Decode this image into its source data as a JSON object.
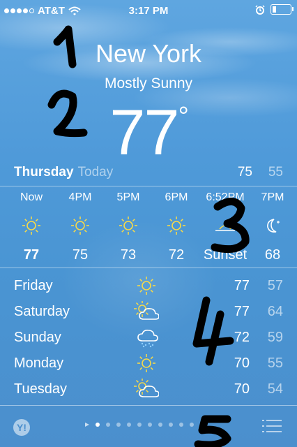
{
  "status": {
    "carrier": "AT&T",
    "time": "3:17 PM"
  },
  "location": {
    "city": "New York",
    "condition": "Mostly Sunny",
    "temperature": "77",
    "degree": "°"
  },
  "today": {
    "day": "Thursday",
    "label": "Today",
    "high": "75",
    "low": "55"
  },
  "hourly": [
    {
      "time": "Now",
      "icon": "sun-icon",
      "value": "77"
    },
    {
      "time": "4PM",
      "icon": "sun-icon",
      "value": "75"
    },
    {
      "time": "5PM",
      "icon": "sun-icon",
      "value": "73"
    },
    {
      "time": "6PM",
      "icon": "sun-icon",
      "value": "72"
    },
    {
      "time": "6:52PM",
      "icon": "sunset-icon",
      "value": "Sunset"
    },
    {
      "time": "7PM",
      "icon": "moon-icon",
      "value": "68"
    }
  ],
  "daily": [
    {
      "day": "Friday",
      "icon": "sun-icon",
      "high": "77",
      "low": "57"
    },
    {
      "day": "Saturday",
      "icon": "partly-cloudy-icon",
      "high": "77",
      "low": "64"
    },
    {
      "day": "Sunday",
      "icon": "rain-icon",
      "high": "72",
      "low": "59"
    },
    {
      "day": "Monday",
      "icon": "sun-icon",
      "high": "70",
      "low": "55"
    },
    {
      "day": "Tuesday",
      "icon": "partly-cloudy-icon",
      "high": "70",
      "low": "54"
    }
  ],
  "footer": {
    "logo": "Y!",
    "page_count": 11,
    "current_page": 2
  },
  "annotations": [
    "1",
    "2",
    "3",
    "4",
    "5"
  ],
  "colors": {
    "sun": "#f5d94a",
    "background_top": "#5fa6e0",
    "background_bottom": "#4b8fcd"
  }
}
